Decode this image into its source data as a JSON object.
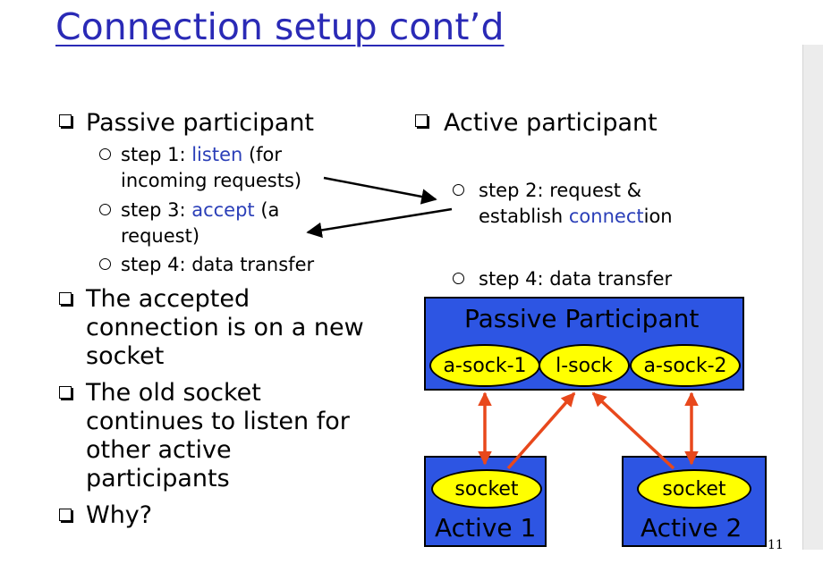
{
  "slide": {
    "title": "Connection setup cont’d",
    "page_number": "11"
  },
  "left_column": {
    "passive_heading": "Passive participant",
    "step1": {
      "prefix": "step 1: ",
      "keyword": "listen",
      "suffix": " (for",
      "line2": "incoming requests)"
    },
    "step3": {
      "prefix": "step 3: ",
      "keyword": "accept",
      "suffix": " (a",
      "line2": "request)"
    },
    "step4": "step 4: data transfer",
    "accepted": [
      "The accepted",
      "connection is on a new",
      "socket"
    ],
    "old_socket": [
      "The old socket",
      "continues to listen for",
      "other active",
      "participants"
    ],
    "why": "Why?"
  },
  "right_column": {
    "active_heading": "Active participant",
    "step2": {
      "line1": "step 2: request &",
      "prefix2": "establish ",
      "keyword": "connect",
      "suffix2": "ion"
    },
    "step4": "step 4: data transfer"
  },
  "diagram": {
    "passive_box_label": "Passive Participant",
    "sockets": [
      "a-sock-1",
      "l-sock",
      "a-sock-2"
    ],
    "active1": {
      "socket": "socket",
      "label": "Active 1"
    },
    "active2": {
      "socket": "socket",
      "label": "Active 2"
    }
  },
  "colors": {
    "title": "#2a2ab6",
    "keyword": "#2b3fb8",
    "box_fill": "#2d55e3",
    "oval_fill": "#ffff00",
    "connector": "#e8481c"
  }
}
